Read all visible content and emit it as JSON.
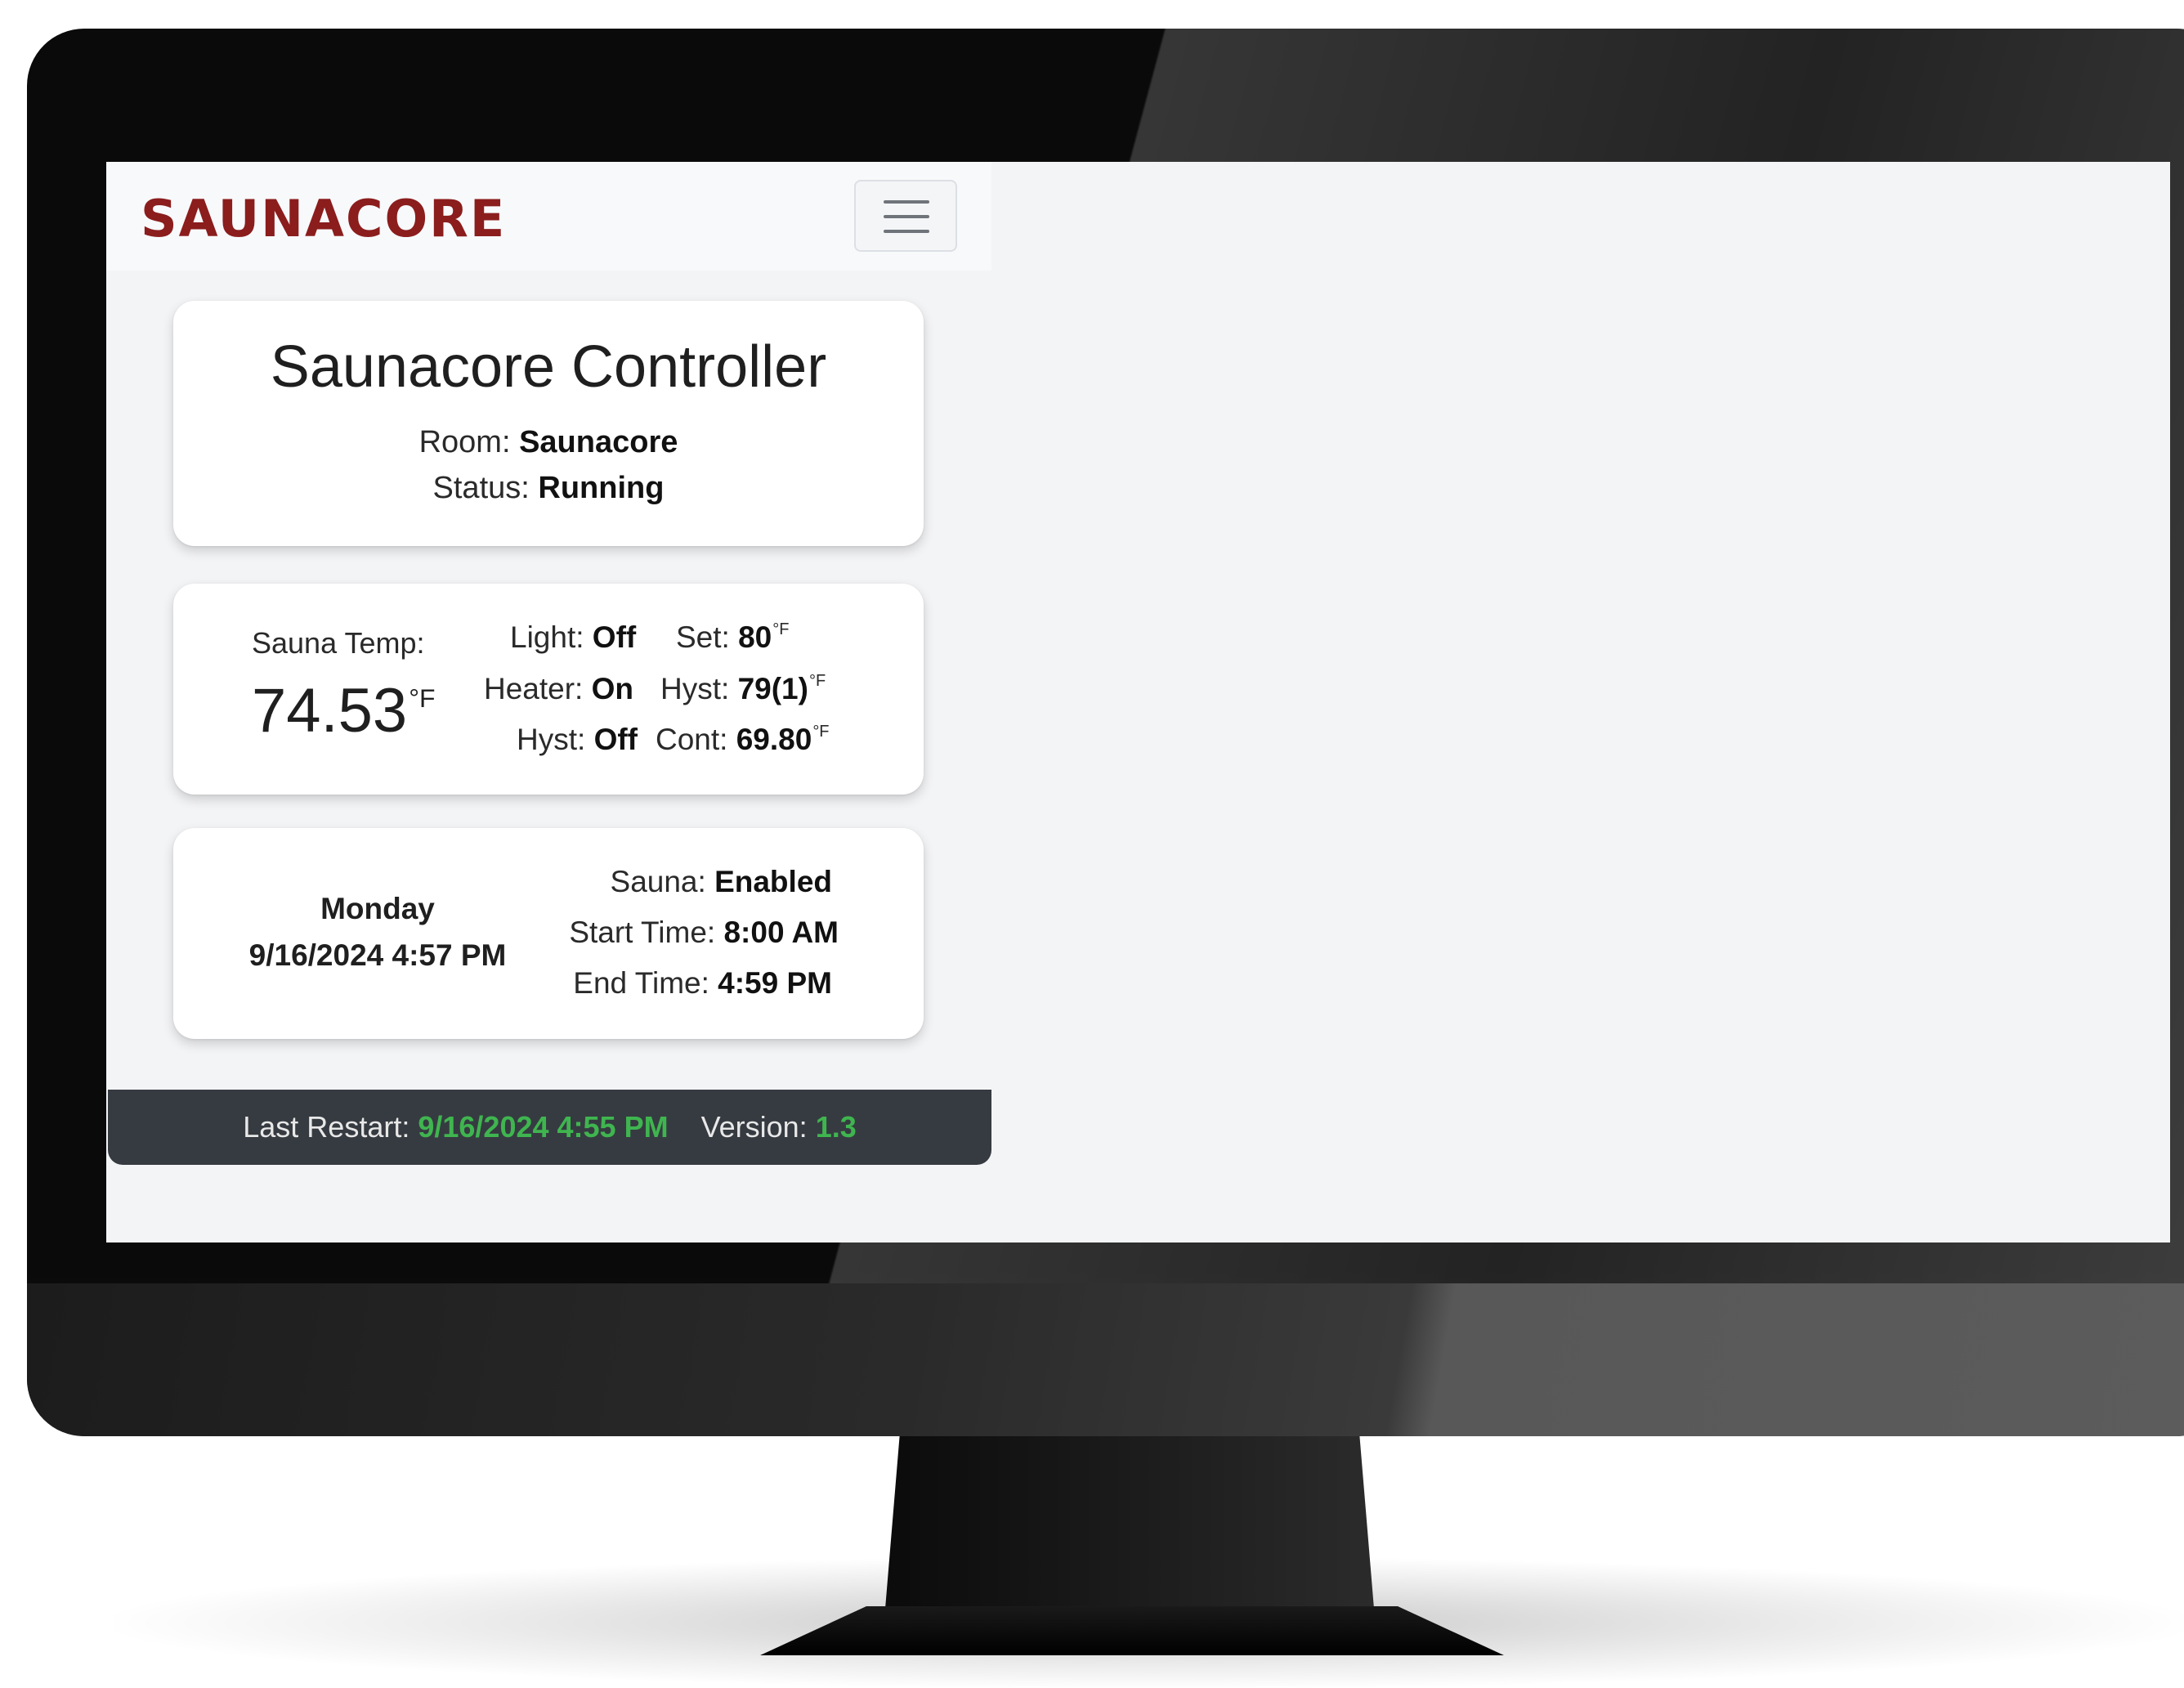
{
  "brand": {
    "logo_text": "SAUNACORE",
    "logo_color": "#8b1d1d",
    "menu_icon": "hamburger-icon"
  },
  "controller": {
    "title": "Saunacore Controller",
    "room_label": "Room:",
    "room_value": "Saunacore",
    "status_label": "Status:",
    "status_value": "Running"
  },
  "temperature": {
    "label": "Sauna Temp:",
    "value": "74.53",
    "unit": "°F",
    "light_label": "Light:",
    "light_value": "Off",
    "set_label": "Set:",
    "set_value": "80",
    "set_unit": "°F",
    "heater_label": "Heater:",
    "heater_value": "On",
    "hyst_label": "Hyst:",
    "hyst_value": "79(1)",
    "hyst_unit": "°F",
    "hyst2_label": "Hyst:",
    "hyst2_value": "Off",
    "cont_label": "Cont:",
    "cont_value": "69.80",
    "cont_unit": "°F"
  },
  "schedule": {
    "day": "Monday",
    "datetime": "9/16/2024 4:57 PM",
    "sauna_label": "Sauna:",
    "sauna_value": "Enabled",
    "start_label": "Start Time:",
    "start_value": "8:00 AM",
    "end_label": "End Time:",
    "end_value": "4:59 PM"
  },
  "footer": {
    "restart_label": "Last Restart:",
    "restart_value": "9/16/2024 4:55 PM",
    "version_label": "Version:",
    "version_value": "1.3",
    "accent_color": "#3fb54f"
  }
}
